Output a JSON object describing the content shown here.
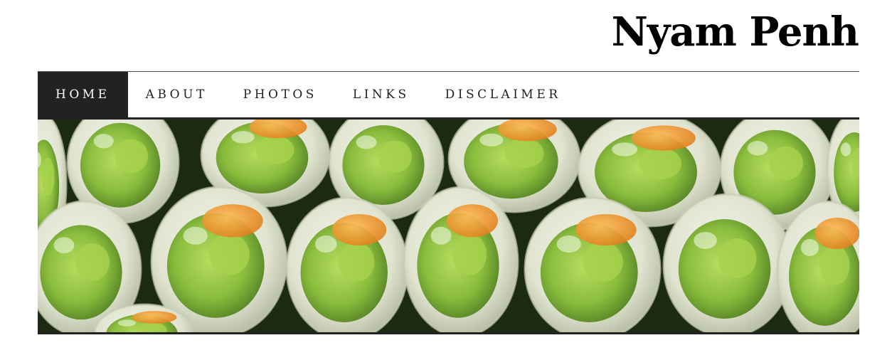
{
  "site": {
    "title": "Nyam Penh"
  },
  "nav": {
    "items": [
      {
        "label": "HOME",
        "active": true
      },
      {
        "label": "ABOUT",
        "active": false
      },
      {
        "label": "PHOTOS",
        "active": false
      },
      {
        "label": "LINKS",
        "active": false
      },
      {
        "label": "DISCLAIMER",
        "active": false
      }
    ]
  },
  "banner": {
    "subject": "spring-rolls-photo",
    "colors": {
      "wrapper": "#e9ecdd",
      "lettuce": "#8cc23a",
      "carrot": "#f29a2e",
      "shadow": "#1a2410"
    }
  }
}
